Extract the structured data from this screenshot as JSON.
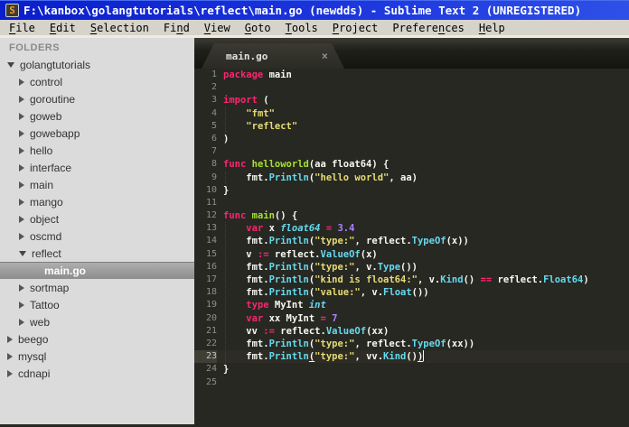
{
  "window": {
    "title": "F:\\kanbox\\golangtutorials\\reflect\\main.go (newdds) - Sublime Text 2 (UNREGISTERED)",
    "icon_letter": "S"
  },
  "menu": {
    "items": [
      {
        "label": "File",
        "mnemonic_index": 0
      },
      {
        "label": "Edit",
        "mnemonic_index": 0
      },
      {
        "label": "Selection",
        "mnemonic_index": 0
      },
      {
        "label": "Find",
        "mnemonic_index": 2
      },
      {
        "label": "View",
        "mnemonic_index": 0
      },
      {
        "label": "Goto",
        "mnemonic_index": 0
      },
      {
        "label": "Tools",
        "mnemonic_index": 0
      },
      {
        "label": "Project",
        "mnemonic_index": 0
      },
      {
        "label": "Preferences",
        "mnemonic_index": 7
      },
      {
        "label": "Help",
        "mnemonic_index": 0
      }
    ]
  },
  "sidebar": {
    "header": "FOLDERS",
    "items": [
      {
        "label": "golangtutorials",
        "level": 0,
        "state": "expanded",
        "selected": false
      },
      {
        "label": "control",
        "level": 1,
        "state": "collapsed",
        "selected": false
      },
      {
        "label": "goroutine",
        "level": 1,
        "state": "collapsed",
        "selected": false
      },
      {
        "label": "goweb",
        "level": 1,
        "state": "collapsed",
        "selected": false
      },
      {
        "label": "gowebapp",
        "level": 1,
        "state": "collapsed",
        "selected": false
      },
      {
        "label": "hello",
        "level": 1,
        "state": "collapsed",
        "selected": false
      },
      {
        "label": "interface",
        "level": 1,
        "state": "collapsed",
        "selected": false
      },
      {
        "label": "main",
        "level": 1,
        "state": "collapsed",
        "selected": false
      },
      {
        "label": "mango",
        "level": 1,
        "state": "collapsed",
        "selected": false
      },
      {
        "label": "object",
        "level": 1,
        "state": "collapsed",
        "selected": false
      },
      {
        "label": "oscmd",
        "level": 1,
        "state": "collapsed",
        "selected": false
      },
      {
        "label": "reflect",
        "level": 1,
        "state": "expanded",
        "selected": false
      },
      {
        "label": "main.go",
        "level": 2,
        "state": "file",
        "selected": true
      },
      {
        "label": "sortmap",
        "level": 1,
        "state": "collapsed",
        "selected": false
      },
      {
        "label": "Tattoo",
        "level": 1,
        "state": "collapsed",
        "selected": false
      },
      {
        "label": "web",
        "level": 1,
        "state": "collapsed",
        "selected": false
      },
      {
        "label": "beego",
        "level": 0,
        "state": "collapsed",
        "selected": false
      },
      {
        "label": "mysql",
        "level": 0,
        "state": "collapsed",
        "selected": false
      },
      {
        "label": "cdnapi",
        "level": 0,
        "state": "collapsed",
        "selected": false
      }
    ]
  },
  "editor": {
    "tab": {
      "label": "main.go",
      "close_glyph": "×",
      "active": true
    },
    "current_line": 23,
    "guides": [
      {
        "from_line": 4,
        "to_line": 5
      },
      {
        "from_line": 9,
        "to_line": 9
      },
      {
        "from_line": 13,
        "to_line": 23
      }
    ],
    "lines": [
      {
        "num": 1,
        "tokens": [
          [
            "k",
            "package"
          ],
          [
            "w",
            " main"
          ]
        ]
      },
      {
        "num": 2,
        "tokens": []
      },
      {
        "num": 3,
        "tokens": [
          [
            "k",
            "import"
          ],
          [
            "w",
            " ("
          ]
        ]
      },
      {
        "num": 4,
        "tokens": [
          [
            "w",
            "    "
          ],
          [
            "s",
            "\"fmt\""
          ]
        ]
      },
      {
        "num": 5,
        "tokens": [
          [
            "w",
            "    "
          ],
          [
            "s",
            "\"reflect\""
          ]
        ]
      },
      {
        "num": 6,
        "tokens": [
          [
            "w",
            ")"
          ]
        ]
      },
      {
        "num": 7,
        "tokens": []
      },
      {
        "num": 8,
        "tokens": [
          [
            "k",
            "func"
          ],
          [
            "w",
            " "
          ],
          [
            "g",
            "helloworld"
          ],
          [
            "w",
            "(aa float64) {"
          ]
        ]
      },
      {
        "num": 9,
        "tokens": [
          [
            "w",
            "    fmt."
          ],
          [
            "f",
            "Println"
          ],
          [
            "w",
            "("
          ],
          [
            "s",
            "\"hello world\""
          ],
          [
            "w",
            ", aa)"
          ]
        ]
      },
      {
        "num": 10,
        "tokens": [
          [
            "w",
            "}"
          ]
        ]
      },
      {
        "num": 11,
        "tokens": []
      },
      {
        "num": 12,
        "tokens": [
          [
            "k",
            "func"
          ],
          [
            "w",
            " "
          ],
          [
            "g",
            "main"
          ],
          [
            "w",
            "() {"
          ]
        ]
      },
      {
        "num": 13,
        "tokens": [
          [
            "w",
            "    "
          ],
          [
            "k",
            "var"
          ],
          [
            "w",
            " x "
          ],
          [
            "t",
            "float64"
          ],
          [
            "w",
            " "
          ],
          [
            "k",
            "="
          ],
          [
            "w",
            " "
          ],
          [
            "n",
            "3.4"
          ]
        ]
      },
      {
        "num": 14,
        "tokens": [
          [
            "w",
            "    fmt."
          ],
          [
            "f",
            "Println"
          ],
          [
            "w",
            "("
          ],
          [
            "s",
            "\"type:\""
          ],
          [
            "w",
            ", reflect."
          ],
          [
            "f",
            "TypeOf"
          ],
          [
            "w",
            "(x))"
          ]
        ]
      },
      {
        "num": 15,
        "tokens": [
          [
            "w",
            "    v "
          ],
          [
            "k",
            ":="
          ],
          [
            "w",
            " reflect."
          ],
          [
            "f",
            "ValueOf"
          ],
          [
            "w",
            "(x)"
          ]
        ]
      },
      {
        "num": 16,
        "tokens": [
          [
            "w",
            "    fmt."
          ],
          [
            "f",
            "Println"
          ],
          [
            "w",
            "("
          ],
          [
            "s",
            "\"type:\""
          ],
          [
            "w",
            ", v."
          ],
          [
            "f",
            "Type"
          ],
          [
            "w",
            "())"
          ]
        ]
      },
      {
        "num": 17,
        "tokens": [
          [
            "w",
            "    fmt."
          ],
          [
            "f",
            "Println"
          ],
          [
            "w",
            "("
          ],
          [
            "s",
            "\"kind is float64:\""
          ],
          [
            "w",
            ", v."
          ],
          [
            "f",
            "Kind"
          ],
          [
            "w",
            "() "
          ],
          [
            "k",
            "=="
          ],
          [
            "w",
            " reflect."
          ],
          [
            "f",
            "Float64"
          ],
          [
            "w",
            ")"
          ]
        ]
      },
      {
        "num": 18,
        "tokens": [
          [
            "w",
            "    fmt."
          ],
          [
            "f",
            "Println"
          ],
          [
            "w",
            "("
          ],
          [
            "s",
            "\"value:\""
          ],
          [
            "w",
            ", v."
          ],
          [
            "f",
            "Float"
          ],
          [
            "w",
            "())"
          ]
        ]
      },
      {
        "num": 19,
        "tokens": [
          [
            "w",
            "    "
          ],
          [
            "k",
            "type"
          ],
          [
            "w",
            " MyInt "
          ],
          [
            "t",
            "int"
          ]
        ]
      },
      {
        "num": 20,
        "tokens": [
          [
            "w",
            "    "
          ],
          [
            "k",
            "var"
          ],
          [
            "w",
            " xx MyInt "
          ],
          [
            "k",
            "="
          ],
          [
            "w",
            " "
          ],
          [
            "n",
            "7"
          ]
        ]
      },
      {
        "num": 21,
        "tokens": [
          [
            "w",
            "    vv "
          ],
          [
            "k",
            ":="
          ],
          [
            "w",
            " reflect."
          ],
          [
            "f",
            "ValueOf"
          ],
          [
            "w",
            "(xx)"
          ]
        ]
      },
      {
        "num": 22,
        "tokens": [
          [
            "w",
            "    fmt."
          ],
          [
            "f",
            "Println"
          ],
          [
            "w",
            "("
          ],
          [
            "s",
            "\"type:\""
          ],
          [
            "w",
            ", reflect."
          ],
          [
            "f",
            "TypeOf"
          ],
          [
            "w",
            "(xx))"
          ]
        ]
      },
      {
        "num": 23,
        "tokens": [
          [
            "w",
            "    fmt."
          ],
          [
            "f",
            "Println"
          ],
          [
            "u",
            "("
          ],
          [
            "s",
            "\"type:\""
          ],
          [
            "w",
            ", vv."
          ],
          [
            "f",
            "Kind"
          ],
          [
            "w",
            "()"
          ],
          [
            "u",
            ")"
          ]
        ],
        "cursor": true
      },
      {
        "num": 24,
        "tokens": [
          [
            "w",
            "}"
          ]
        ]
      },
      {
        "num": 25,
        "tokens": []
      }
    ]
  },
  "colors": {
    "titlebar_blue": "#1c36dc",
    "menu_bg": "#d6d3ca",
    "sidebar_bg": "#dbdbdb",
    "editor_bg": "#272822",
    "keyword": "#f92672",
    "string": "#e6db74",
    "number": "#ae81ff",
    "type_italic": "#66d9ef",
    "function_call": "#66d9ef",
    "function_name": "#a6e22e",
    "selection_gray": "#9a9a9a"
  }
}
